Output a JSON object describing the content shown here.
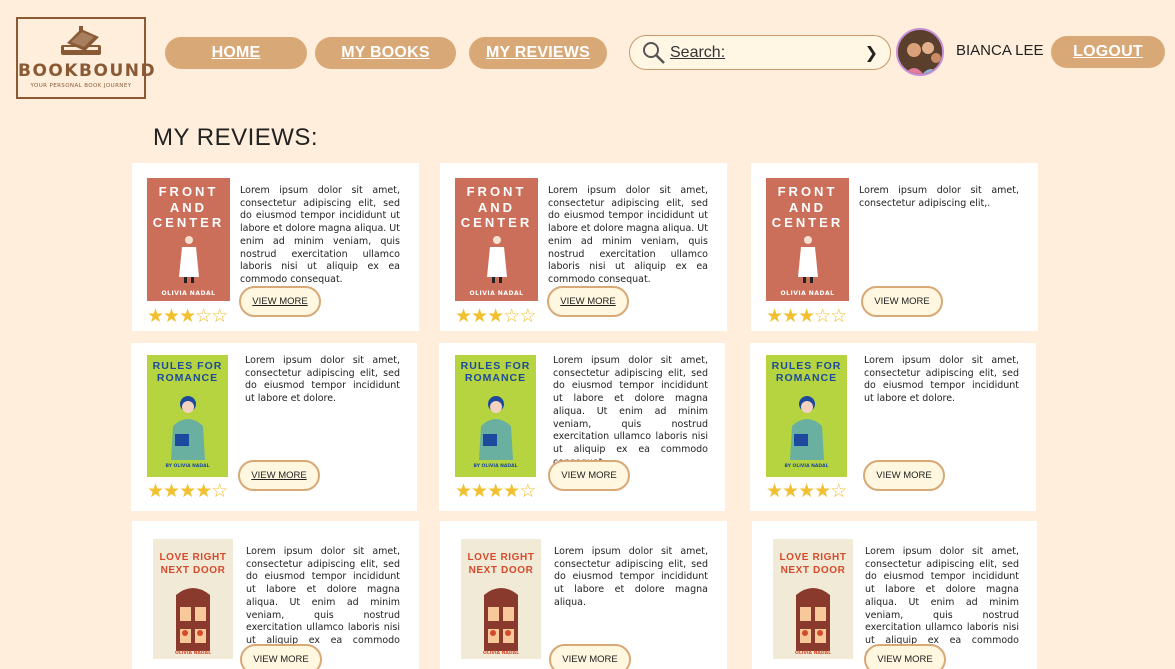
{
  "logo": {
    "brand": "BOOKBOUND",
    "tagline": "YOUR PERSONAL BOOK JOURNEY",
    "icon": "book-stack-icon"
  },
  "nav": {
    "home": "HOME",
    "my_books": "MY BOOKS",
    "my_reviews": "MY REVIEWS",
    "logout": "LOGOUT"
  },
  "search": {
    "label": "Search:",
    "icon": "search-icon",
    "submit_icon": "chevron-right-icon"
  },
  "user": {
    "name": "BIANCA LEE"
  },
  "page": {
    "title": "MY REVIEWS:"
  },
  "view_more_label": "VIEW MORE",
  "colors": {
    "background": "#ffeedb",
    "accent": "#d9a877",
    "star": "#f0c030"
  },
  "books": {
    "fac": {
      "title_lines": [
        "FRONT",
        "AND",
        "CENTER"
      ],
      "author": "OLIVIA NADAL"
    },
    "rfr": {
      "title_lines": [
        "RULES FOR",
        "ROMANCE"
      ],
      "author": "BY OLIVIA NADAL"
    },
    "lrn": {
      "title_lines": [
        "LOVE RIGHT",
        "NEXT DOOR"
      ],
      "author": "OLIVIA NADAL"
    }
  },
  "reviews": [
    {
      "book": "FRONT AND CENTER",
      "rating": 3,
      "text": "Lorem ipsum dolor sit amet, consectetur adipiscing elit, sed do eiusmod tempor incididunt ut labore et dolore magna aliqua. Ut enim ad minim veniam, quis nostrud exercitation ullamco laboris nisi ut aliquip ex ea commodo consequat."
    },
    {
      "book": "FRONT AND CENTER",
      "rating": 3,
      "text": "Lorem ipsum dolor sit amet, consectetur adipiscing elit, sed do eiusmod tempor incididunt ut labore et dolore magna aliqua. Ut enim ad minim veniam, quis nostrud exercitation ullamco laboris nisi ut aliquip ex ea commodo consequat."
    },
    {
      "book": "FRONT AND CENTER",
      "rating": 3,
      "text": "Lorem ipsum dolor sit amet, consectetur adipiscing elit,."
    },
    {
      "book": "RULES FOR ROMANCE",
      "rating": 4,
      "text": "Lorem ipsum dolor sit amet, consectetur adipiscing elit, sed do eiusmod tempor incididunt ut labore et dolore."
    },
    {
      "book": "RULES FOR ROMANCE",
      "rating": 4,
      "text": "Lorem ipsum dolor sit amet, consectetur adipiscing elit, sed do eiusmod tempor incididunt ut labore et dolore magna aliqua. Ut enim ad minim veniam, quis nostrud exercitation ullamco laboris nisi ut aliquip ex ea commodo consequat."
    },
    {
      "book": "RULES FOR ROMANCE",
      "rating": 4,
      "text": "Lorem ipsum dolor sit amet, consectetur adipiscing elit, sed do eiusmod tempor incididunt ut labore et dolore."
    },
    {
      "book": "LOVE RIGHT NEXT DOOR",
      "rating": 0,
      "text": "Lorem ipsum dolor sit amet, consectetur adipiscing elit, sed do eiusmod tempor incididunt ut labore et dolore magna aliqua. Ut enim ad minim veniam, quis nostrud exercitation ullamco laboris nisi ut aliquip ex ea commodo consequat."
    },
    {
      "book": "LOVE RIGHT NEXT DOOR",
      "rating": 0,
      "text": "Lorem ipsum dolor sit amet, consectetur adipiscing elit, sed do eiusmod tempor incididunt ut labore et dolore magna aliqua."
    },
    {
      "book": "LOVE RIGHT NEXT DOOR",
      "rating": 0,
      "text": "Lorem ipsum dolor sit amet, consectetur adipiscing elit, sed do eiusmod tempor incididunt ut labore et dolore magna aliqua. Ut enim ad minim veniam, quis nostrud exercitation ullamco laboris nisi ut aliquip ex ea commodo consequat."
    }
  ]
}
